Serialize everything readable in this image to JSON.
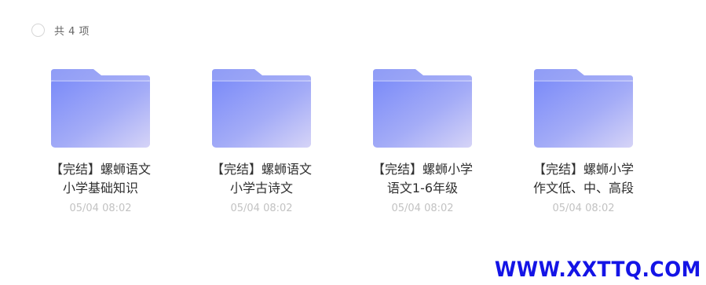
{
  "header": {
    "select_all_icon": "circle-checkbox-icon",
    "count_label": "共 4 项"
  },
  "files": [
    {
      "name": "【完结】螺蛳语文\n小学基础知识",
      "time": "05/04 08:02",
      "icon": "folder-icon"
    },
    {
      "name": "【完结】螺蛳语文\n小学古诗文",
      "time": "05/04 08:02",
      "icon": "folder-icon"
    },
    {
      "name": "【完结】螺蛳小学\n语文1-6年级",
      "time": "05/04 08:02",
      "icon": "folder-icon"
    },
    {
      "name": "【完结】螺蛳小学\n作文低、中、高段",
      "time": "05/04 08:02",
      "icon": "folder-icon"
    }
  ],
  "watermark": "WWW.XXTTQ.COM",
  "colors": {
    "folder_back": "#9aa6f7",
    "folder_front_start": "#7e8ef8",
    "folder_front_end": "#d4d2f7",
    "watermark": "#1414e6"
  }
}
